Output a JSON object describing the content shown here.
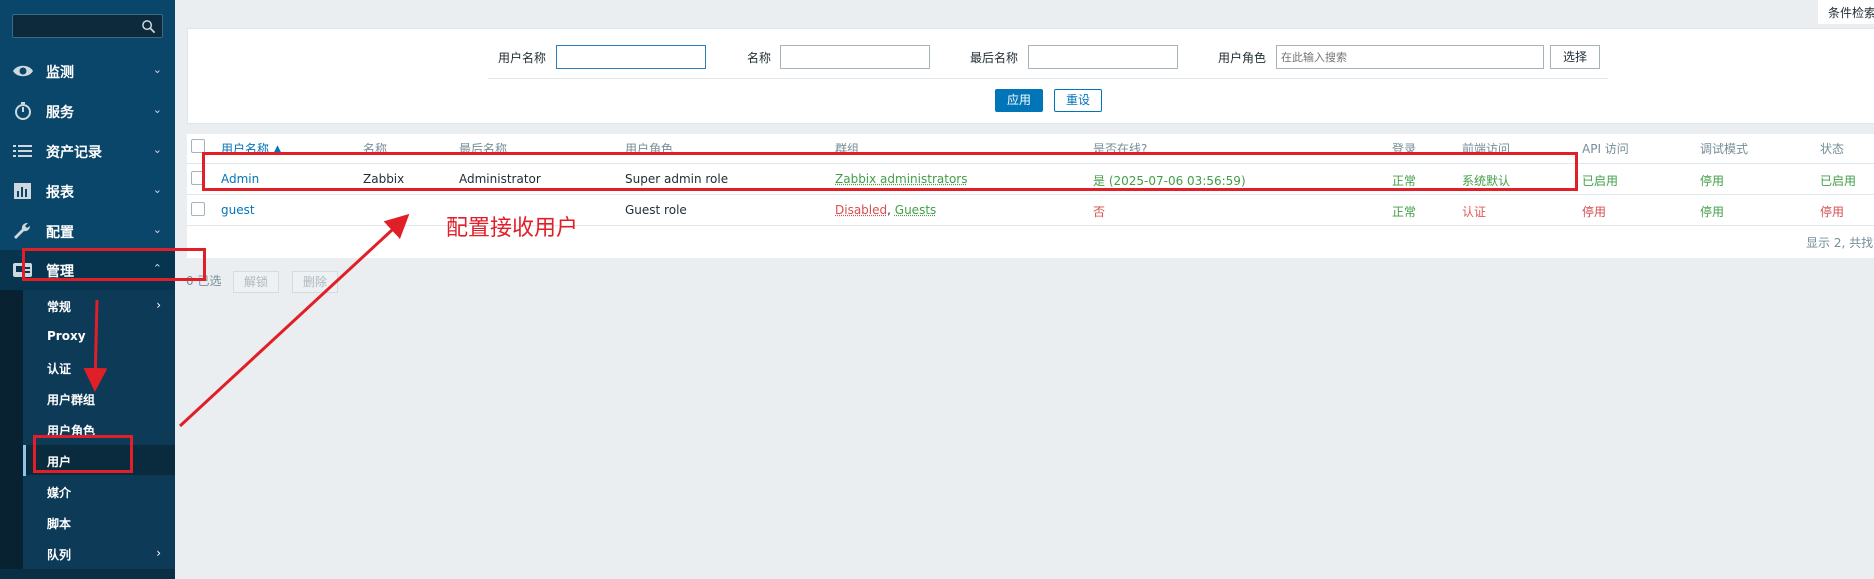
{
  "sidebar": {
    "search_placeholder": "",
    "menu": [
      {
        "label": "监测",
        "icon": "eye-icon",
        "chevron": "⌄"
      },
      {
        "label": "服务",
        "icon": "stopwatch-icon",
        "chevron": "⌄"
      },
      {
        "label": "资产记录",
        "icon": "list-icon",
        "chevron": "⌄"
      },
      {
        "label": "报表",
        "icon": "bar-chart-icon",
        "chevron": "⌄"
      },
      {
        "label": "配置",
        "icon": "wrench-icon",
        "chevron": "⌄"
      },
      {
        "label": "管理",
        "icon": "admin-icon",
        "chevron": "⌃"
      }
    ],
    "submenu": [
      {
        "label": "常规",
        "chevron": "›"
      },
      {
        "label": "Proxy",
        "chevron": ""
      },
      {
        "label": "认证",
        "chevron": ""
      },
      {
        "label": "用户群组",
        "chevron": ""
      },
      {
        "label": "用户角色",
        "chevron": ""
      },
      {
        "label": "用户",
        "chevron": ""
      },
      {
        "label": "媒介",
        "chevron": ""
      },
      {
        "label": "脚本",
        "chevron": ""
      },
      {
        "label": "队列",
        "chevron": "›"
      }
    ]
  },
  "filter": {
    "tab_label": "条件检索",
    "username_label": "用户名称",
    "username_value": "",
    "name_label": "名称",
    "name_value": "",
    "surname_label": "最后名称",
    "surname_value": "",
    "role_label": "用户角色",
    "role_placeholder": "在此输入搜索",
    "select_button": "选择",
    "apply_button": "应用",
    "reset_button": "重设"
  },
  "table": {
    "headers": {
      "username": "用户名称 ▲",
      "name": "名称",
      "surname": "最后名称",
      "role": "用户角色",
      "groups": "群组",
      "online": "是否在线?",
      "login": "登录",
      "frontend": "前端访问",
      "api": "API 访问",
      "debug": "调试模式",
      "status": "状态"
    },
    "rows": [
      {
        "username": "Admin",
        "name": "Zabbix",
        "surname": "Administrator",
        "role": "Super admin role",
        "groups": "Zabbix administrators",
        "groups_sep": "",
        "groups_second": "",
        "online": "是 (2025-07-06 03:56:59)",
        "login": "正常",
        "frontend": "系统默认",
        "api": "已启用",
        "debug": "停用",
        "status": "已启用"
      },
      {
        "username": "guest",
        "name": "",
        "surname": "",
        "role": "Guest role",
        "groups": "Disabled",
        "groups_sep": ", ",
        "groups_second": "Guests",
        "online": "否",
        "login": "正常",
        "frontend": "认证",
        "api": "停用",
        "debug": "停用",
        "status": "停用"
      }
    ],
    "footer": "显示 2, 共找",
    "selected": "0 已选",
    "unblock_button": "解锁",
    "delete_button": "删除"
  },
  "annotation": {
    "text": "配置接收用户",
    "color": "#e01f28"
  }
}
